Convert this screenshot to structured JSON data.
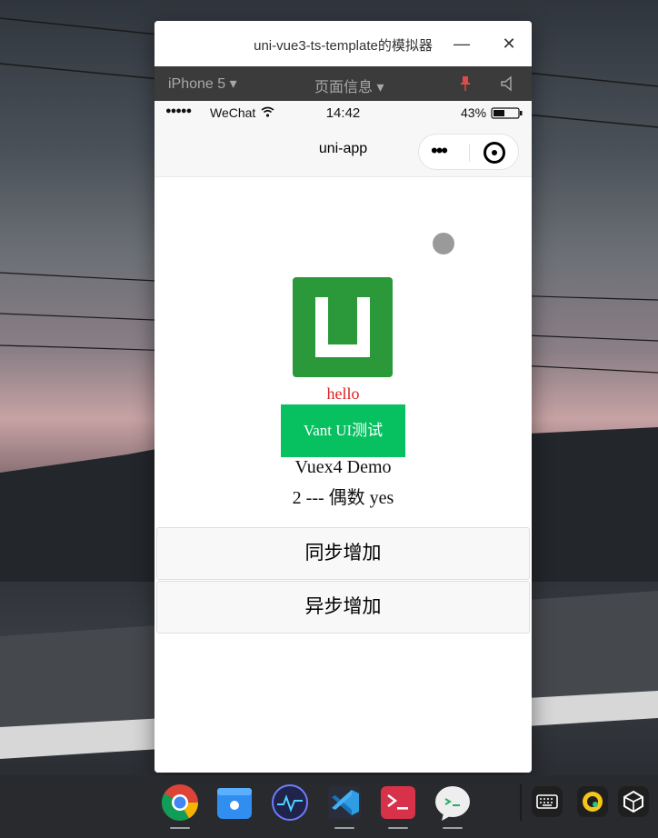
{
  "window": {
    "title": "uni-vue3-ts-template的模拟器",
    "minimize_label": "—",
    "close_label": "✕"
  },
  "toolbar": {
    "device_label": "iPhone 5 ▾",
    "page_info_label": "页面信息 ▾"
  },
  "status_bar": {
    "signal": "●●●●●",
    "carrier": "WeChat",
    "time": "14:42",
    "battery": "43%"
  },
  "nav": {
    "title": "uni-app",
    "more_label": "•••"
  },
  "content": {
    "hello_text": "hello",
    "vant_button_label": "Vant UI测试",
    "vuex_title": "Vuex4 Demo",
    "counter_text": "2 --- 偶数 yes",
    "sync_button_label": "同步增加",
    "async_button_label": "异步增加"
  },
  "taskbar": {
    "apps": [
      "chrome-icon",
      "deepin-appstore-icon",
      "system-monitor-icon",
      "vscode-icon",
      "terminal-icon",
      "wechat-devtools-icon"
    ],
    "tray": [
      "keyboard-icon",
      "qq-icon",
      "settings-icon"
    ]
  },
  "colors": {
    "logo_green": "#2b9939",
    "vant_green": "#07c160",
    "hello_red": "#dd2222"
  }
}
